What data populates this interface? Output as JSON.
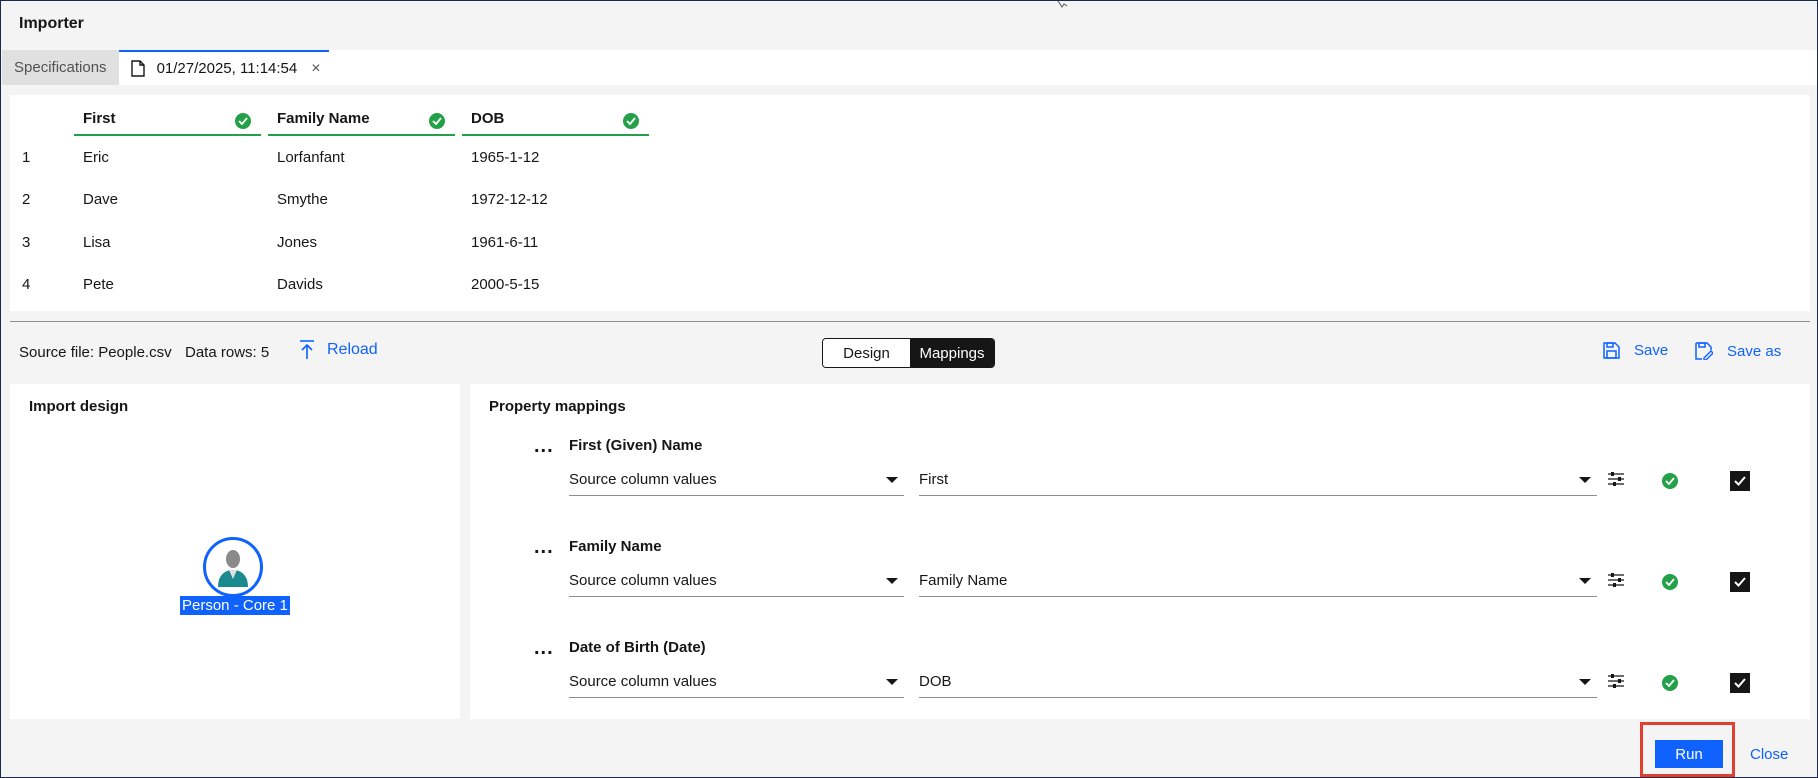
{
  "window": {
    "title": "Importer"
  },
  "tabs": [
    {
      "label": "Specifications",
      "active": false
    },
    {
      "label": "01/27/2025, 11:14:54",
      "active": true,
      "icon": "document-icon",
      "close": "×"
    }
  ],
  "grid": {
    "columns": [
      {
        "label": "First",
        "status": "valid"
      },
      {
        "label": "Family Name",
        "status": "valid"
      },
      {
        "label": "DOB",
        "status": "valid"
      }
    ],
    "rows": [
      {
        "index": "1",
        "first": "Eric",
        "family": "Lorfanfant",
        "dob": "1965-1-12"
      },
      {
        "index": "2",
        "first": "Dave",
        "family": "Smythe",
        "dob": "1972-12-12"
      },
      {
        "index": "3",
        "first": "Lisa",
        "family": "Jones",
        "dob": "1961-6-11"
      },
      {
        "index": "4",
        "first": "Pete",
        "family": "Davids",
        "dob": "2000-5-15"
      }
    ]
  },
  "toolbar": {
    "source_file": "Source file: People.csv",
    "data_rows": "Data rows: 5",
    "reload_label": "Reload",
    "view_toggle": {
      "design": "Design",
      "mappings": "Mappings",
      "selected": "Mappings"
    },
    "save_label": "Save",
    "save_as_label": "Save as"
  },
  "design_panel": {
    "title": "Import design",
    "node_label": "Person - Core 1",
    "node_icon": "person-avatar-icon"
  },
  "mappings_panel": {
    "title": "Property mappings",
    "menu_glyph": "...",
    "items": [
      {
        "name": "First (Given) Name",
        "source_type": "Source column values",
        "column": "First",
        "checked": true
      },
      {
        "name": "Family Name",
        "source_type": "Source column values",
        "column": "Family Name",
        "checked": true
      },
      {
        "name": "Date of Birth (Date)",
        "source_type": "Source column values",
        "column": "DOB",
        "checked": true
      }
    ]
  },
  "footer": {
    "run_label": "Run",
    "close_label": "Close"
  },
  "colors": {
    "accent": "#0f62fe",
    "success": "#24a148",
    "highlight": "#e0402f",
    "dark": "#161616"
  }
}
